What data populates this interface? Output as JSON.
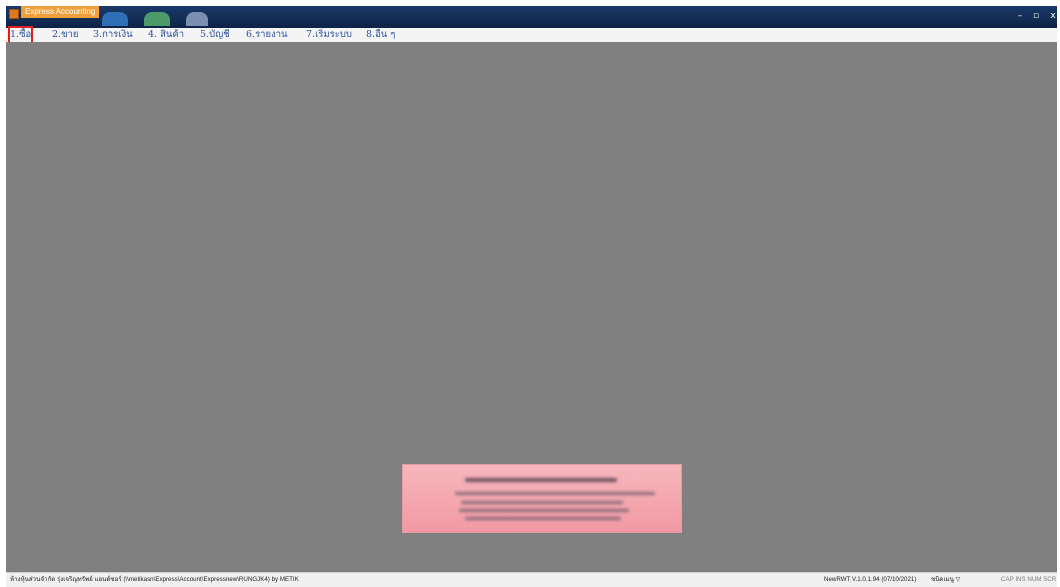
{
  "window": {
    "title": "Express Accounting",
    "controls": {
      "minimize": "–",
      "maximize": "▫",
      "close": "x"
    }
  },
  "menu": {
    "items": [
      {
        "label": "1.ซื้อ"
      },
      {
        "label": "2.ขาย"
      },
      {
        "label": "3.การเงิน"
      },
      {
        "label": "4. สินค้า"
      },
      {
        "label": "5.บัญชี"
      },
      {
        "label": "6.รายงาน"
      },
      {
        "label": "7.เริ่มระบบ"
      },
      {
        "label": "8.อื่น ๆ"
      }
    ]
  },
  "status": {
    "company": "ห้างหุ้นส่วนจำกัด รุ่งเจริญทรัพย์ แอนด์ซอร์ (\\\\metikasn\\Express\\Account\\Expressnew\\RUNGJK4) by METIK",
    "version": "NewRWT V.1.0.1.94 (07/10/2021)",
    "language": "ชนิดเมนู ▽",
    "keys": "CAP INS NUM SCR"
  },
  "colors": {
    "titlebar": "#122c53",
    "workspace": "#808080",
    "notice": "#f4a7b0",
    "menu_text": "#2a4f9a",
    "highlight": "#e02020"
  }
}
